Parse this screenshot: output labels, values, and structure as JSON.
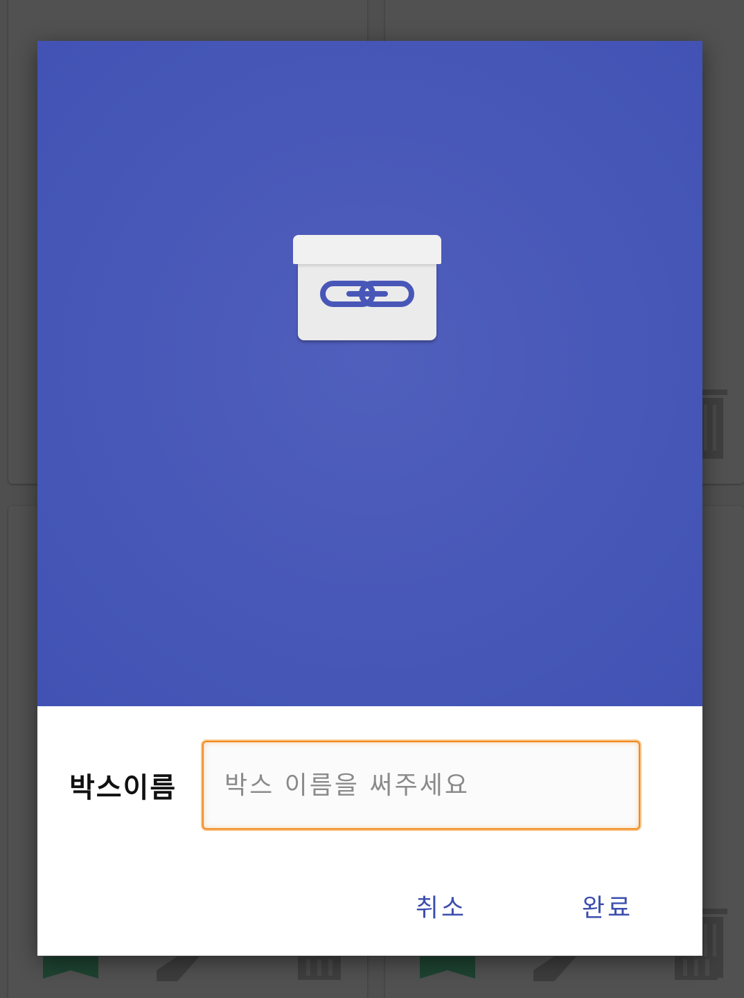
{
  "dialog": {
    "icon": "link-box-icon",
    "header_color": "#4a59b8",
    "field_label": "박스이름",
    "input": {
      "value": "",
      "placeholder": "박스 이름을 써주세요"
    },
    "actions": {
      "cancel_label": "취소",
      "done_label": "완료"
    },
    "accent_color": "#3b4eae",
    "focus_color": "#f08a1e"
  },
  "background": {
    "icons": [
      "trash-icon",
      "trash-icon",
      "bookmark-icon",
      "pencil-icon",
      "trash-icon",
      "bookmark-icon",
      "pencil-icon",
      "trash-icon"
    ]
  }
}
